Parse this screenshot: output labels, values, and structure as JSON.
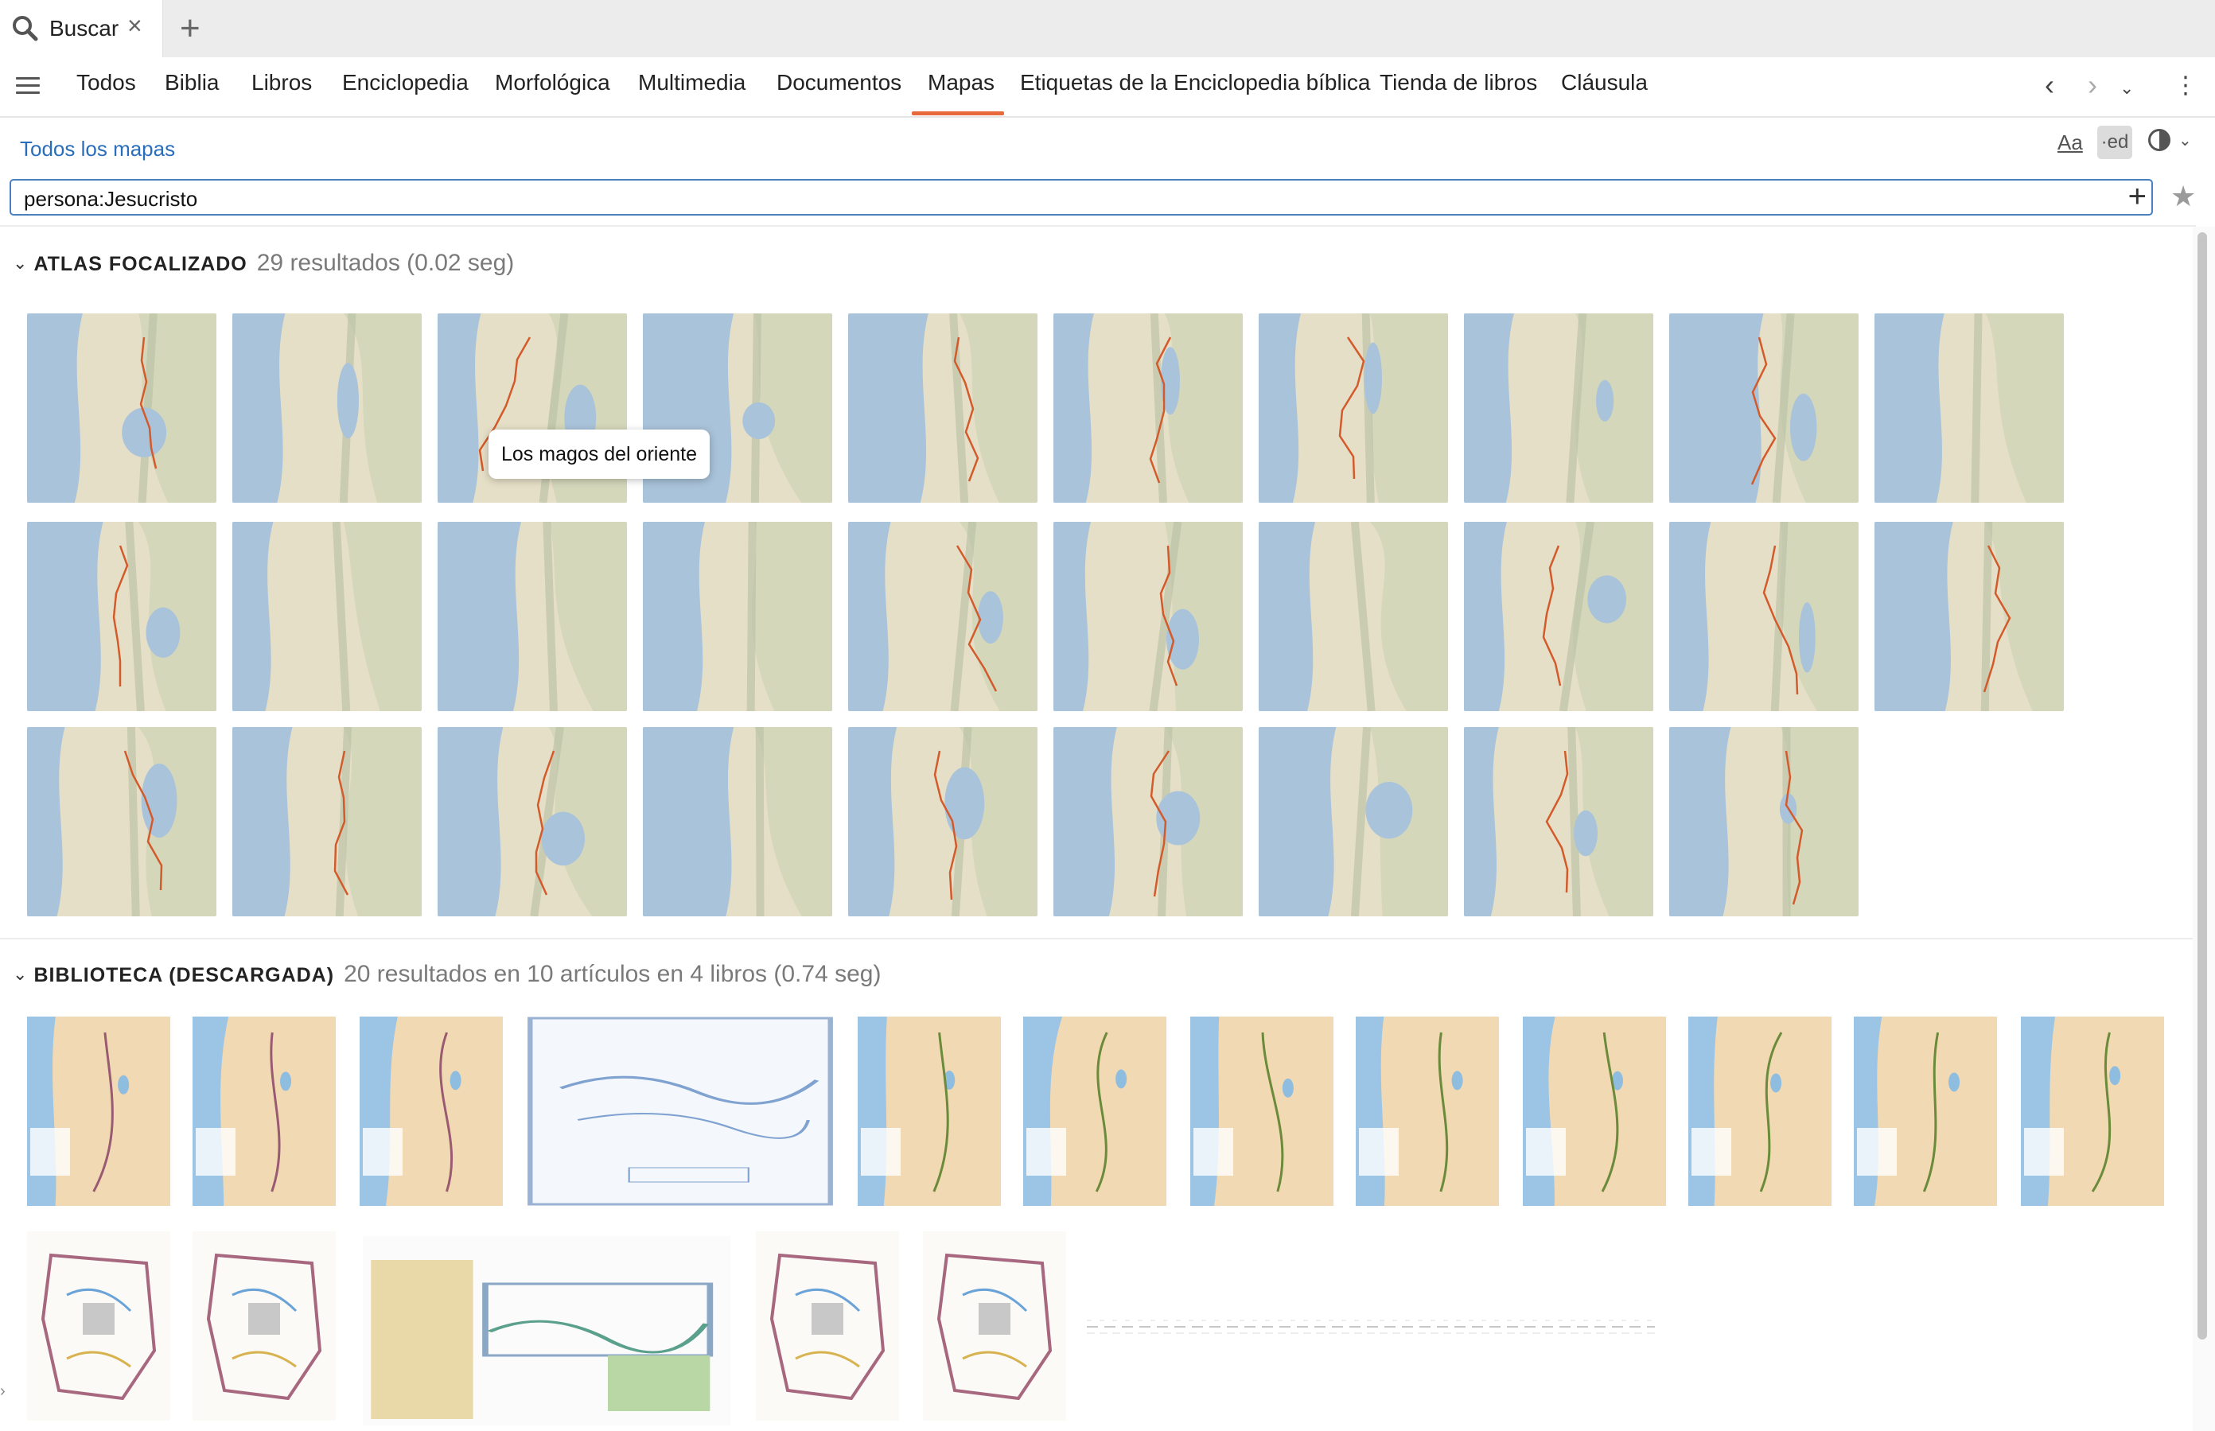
{
  "tab": {
    "label": "Buscar",
    "icon": "search-icon",
    "close_icon": "close-icon",
    "new_tab_icon": "plus-icon"
  },
  "categories": [
    "Todos",
    "Biblia",
    "Libros",
    "Enciclopedia",
    "Morfológica",
    "Multimedia",
    "Documentos",
    "Mapas",
    "Etiquetas de la Enciclopedia bíblica",
    "Tienda de libros",
    "Cláusula"
  ],
  "active_category": "Mapas",
  "colors": {
    "accent": "#e8693c",
    "link": "#2a6ebb",
    "search_border": "#4a7fc0"
  },
  "toolbar": {
    "all_maps_link": "Todos los mapas",
    "aa_label": "Aa",
    "ed_label": "·ed"
  },
  "search": {
    "value": "persona:Jesucristo"
  },
  "sections": {
    "atlas": {
      "title": "ATLAS FOCALIZADO",
      "count": "29 resultados (0.02 seg)",
      "thumbnail_count": 29
    },
    "library": {
      "title": "BIBLIOTECA (DESCARGADA)",
      "count": "20 resultados en 10 artículos en 4 libros (0.74 seg)",
      "thumbnail_count": 18
    }
  },
  "tooltip": "Los magos del oriente"
}
